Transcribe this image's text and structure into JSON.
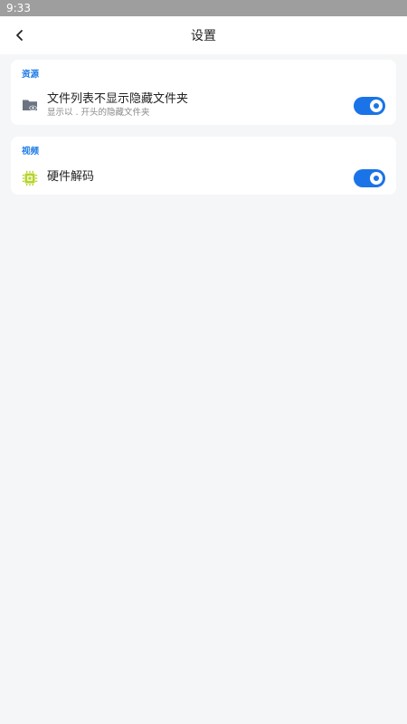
{
  "status_bar": {
    "time": "9:33"
  },
  "header": {
    "title": "设置",
    "back_icon": "chevron-left-icon"
  },
  "sections": [
    {
      "header": "资源",
      "items": [
        {
          "icon": "folder-eye-icon",
          "title": "文件列表不显示隐藏文件夹",
          "subtitle": "显示以 . 开头的隐藏文件夹",
          "enabled": true
        }
      ]
    },
    {
      "header": "视频",
      "items": [
        {
          "icon": "chip-icon",
          "title": "硬件解码",
          "enabled": true
        }
      ]
    }
  ],
  "colors": {
    "accent": "#1a74e8",
    "section_header": "#1a7ae6",
    "chip_icon": "#b5d42a",
    "folder_icon": "#6b7480",
    "background": "#f5f6f8"
  }
}
